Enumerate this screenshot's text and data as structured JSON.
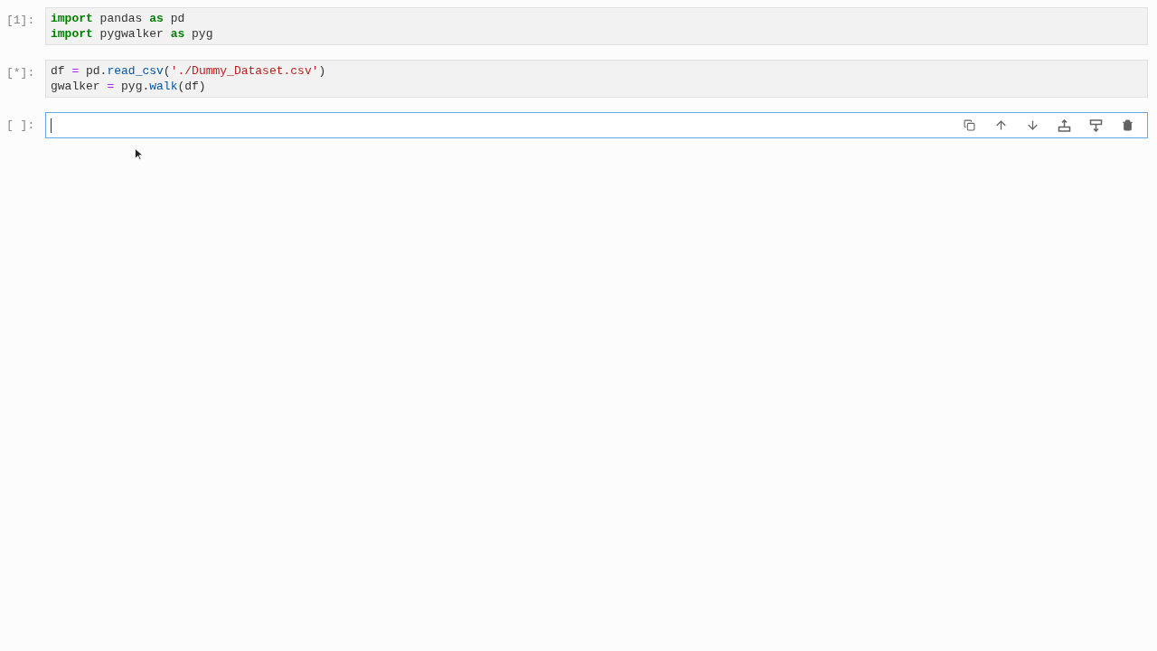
{
  "cells": [
    {
      "prompt": "[1]:",
      "active": false,
      "lines": [
        [
          {
            "kind": "keyword",
            "text": "import"
          },
          {
            "kind": "plain",
            "text": " pandas "
          },
          {
            "kind": "keyword",
            "text": "as"
          },
          {
            "kind": "plain",
            "text": " pd"
          }
        ],
        [
          {
            "kind": "keyword",
            "text": "import"
          },
          {
            "kind": "plain",
            "text": " pygwalker "
          },
          {
            "kind": "keyword",
            "text": "as"
          },
          {
            "kind": "plain",
            "text": " pyg"
          }
        ]
      ]
    },
    {
      "prompt": "[*]:",
      "active": false,
      "lines": [
        [
          {
            "kind": "plain",
            "text": "df "
          },
          {
            "kind": "operator",
            "text": "="
          },
          {
            "kind": "plain",
            "text": " pd."
          },
          {
            "kind": "function",
            "text": "read_csv"
          },
          {
            "kind": "plain",
            "text": "("
          },
          {
            "kind": "string",
            "text": "'./Dummy_Dataset.csv'"
          },
          {
            "kind": "plain",
            "text": ")"
          }
        ],
        [
          {
            "kind": "plain",
            "text": "gwalker "
          },
          {
            "kind": "operator",
            "text": "="
          },
          {
            "kind": "plain",
            "text": " pyg."
          },
          {
            "kind": "function",
            "text": "walk"
          },
          {
            "kind": "plain",
            "text": "(df)"
          }
        ]
      ]
    },
    {
      "prompt": "[ ]:",
      "active": true
    }
  ]
}
